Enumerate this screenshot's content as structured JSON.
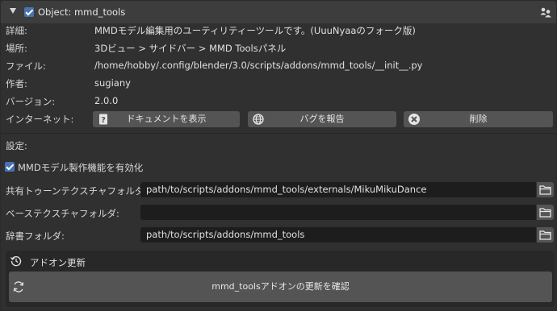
{
  "header": {
    "title": "Object: mmd_tools",
    "enabled": true
  },
  "info_rows": [
    {
      "label": "詳細:",
      "value": "MMDモデル編集用のユーティリティーツールです。(UuuNyaaのフォーク版)"
    },
    {
      "label": "場所:",
      "value": "3Dビュー > サイドバー > MMD Toolsパネル"
    },
    {
      "label": "ファイル:",
      "value": "/home/hobby/.config/blender/3.0/scripts/addons/mmd_tools/__init__.py"
    },
    {
      "label": "作者:",
      "value": "sugiany"
    },
    {
      "label": "バージョン:",
      "value": "2.0.0"
    }
  ],
  "internet": {
    "label": "インターネット:",
    "buttons": {
      "docs": "ドキュメントを表示",
      "report": "バグを報告",
      "remove": "削除"
    }
  },
  "settings": {
    "label": "設定:",
    "checkbox_label": "MMDモデル製作機能を有効化",
    "checkbox_checked": true
  },
  "paths": [
    {
      "label": "共有トゥーンテクスチャフォルダ:",
      "value": "path/to/scripts/addons/mmd_tools/externals/MikuMikuDance"
    },
    {
      "label": "ベーステクスチャフォルダ:",
      "value": ""
    },
    {
      "label": "辞書フォルダ:",
      "value": "path/to/scripts/addons/mmd_tools"
    }
  ],
  "updater": {
    "title": "アドオン更新",
    "button": "mmd_toolsアドオンの更新を確認"
  },
  "colors": {
    "accent": "#4772b3",
    "background": "#303030",
    "button": "#545454",
    "field": "#1d1d1d"
  }
}
